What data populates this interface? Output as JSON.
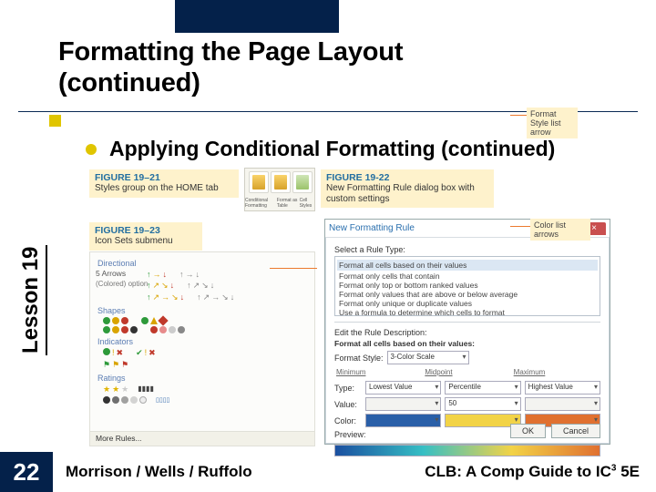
{
  "title_line1": "Formatting the Page Layout",
  "title_line2": "(continued)",
  "bullet1": "Applying Conditional Formatting (continued)",
  "sidetab": "Lesson 19",
  "figures": {
    "f21": {
      "num": "FIGURE 19–21",
      "txt": "Styles group on the HOME tab",
      "btns": [
        "Conditional Formatting",
        "Format as Table",
        "Cell Styles"
      ]
    },
    "f22": {
      "num": "FIGURE 19-22",
      "txt": "New Formatting Rule dialog box with custom settings"
    },
    "f23": {
      "num": "FIGURE 19–23",
      "txt": "Icon Sets submenu",
      "arrows_label1": "5 Arrows",
      "arrows_label2": "(Colored) option",
      "grp_dir": "Directional",
      "grp_shapes": "Shapes",
      "grp_ind": "Indicators",
      "grp_rate": "Ratings",
      "more": "More Rules..."
    }
  },
  "dialog": {
    "title": "New Formatting Rule",
    "sel_type": "Select a Rule Type:",
    "types": [
      "Format all cells based on their values",
      "Format only cells that contain",
      "Format only top or bottom ranked values",
      "Format only values that are above or below average",
      "Format only unique or duplicate values",
      "Use a formula to determine which cells to format"
    ],
    "edit_desc": "Edit the Rule Description:",
    "desc_head": "Format all cells based on their values:",
    "fmt_style_lab": "Format Style:",
    "fmt_style_val": "3-Color Scale",
    "cols": {
      "min": {
        "h": "Minimum",
        "type": "Lowest Value",
        "val": "",
        "color": ""
      },
      "mid": {
        "h": "Midpoint",
        "type": "Percentile",
        "val": "50",
        "color": ""
      },
      "max": {
        "h": "Maximum",
        "type": "Highest Value",
        "val": "",
        "color": ""
      }
    },
    "type_lab": "Type:",
    "val_lab": "Value:",
    "color_lab": "Color:",
    "preview_lab": "Preview:",
    "ok": "OK",
    "cancel": "Cancel"
  },
  "callouts": {
    "c1": "Format Style list arrow",
    "c2": "Color list arrows"
  },
  "page_number": "22",
  "footer_left": "Morrison / Wells / Ruffolo",
  "footer_right_a": "CLB: A Comp Guide to IC",
  "footer_right_sup": "3",
  "footer_right_b": " 5E"
}
